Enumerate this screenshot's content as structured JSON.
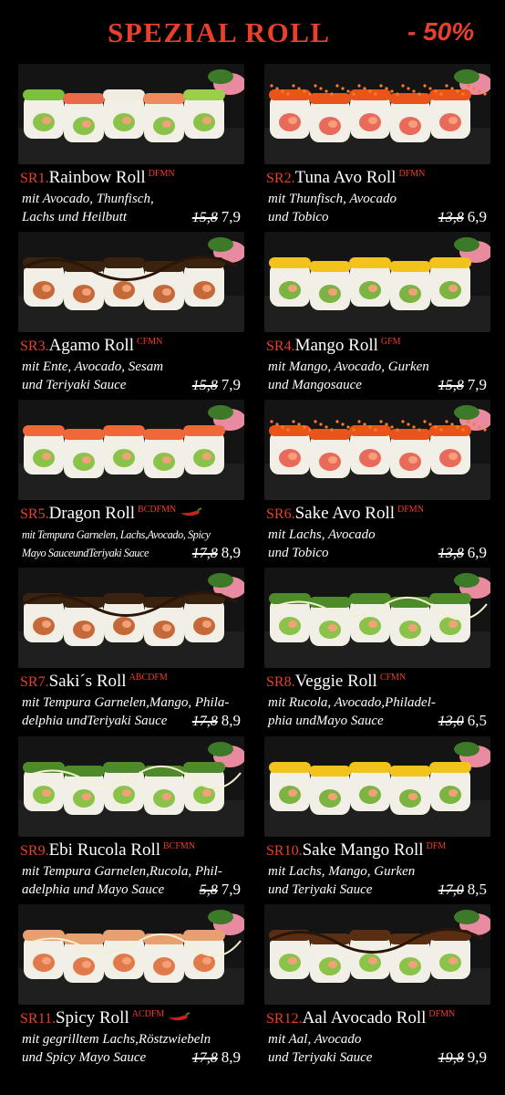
{
  "header": {
    "title": "SPEZIAL ROLL",
    "discount": "- 50%"
  },
  "rolls": [
    {
      "code": "SR1.",
      "name": "Rainbow Roll",
      "tags": "DFMN",
      "chili": false,
      "desc1": "mit Avocado, Thunfisch,",
      "desc2": "Lachs und Heilbutt",
      "old": "15,8",
      "new": "7,9",
      "style": "rainbow"
    },
    {
      "code": "SR2.",
      "name": "Tuna Avo Roll",
      "tags": "DFMN",
      "chili": false,
      "desc1": "mit Thunfisch, Avocado",
      "desc2": "und Tobico",
      "old": "13,8",
      "new": "6,9",
      "style": "tobico"
    },
    {
      "code": "SR3.",
      "name": "Agamo Roll",
      "tags": "CFMN",
      "chili": false,
      "desc1": "mit Ente, Avocado, Sesam",
      "desc2": "und Teriyaki Sauce",
      "old": "15,8",
      "new": "7,9",
      "style": "teriyaki"
    },
    {
      "code": "SR4.",
      "name": "Mango Roll",
      "tags": "GFM",
      "chili": false,
      "desc1": "mit Mango, Avocado, Gurken",
      "desc2": "und Mangosauce",
      "old": "15,8",
      "new": "7,9",
      "style": "mango"
    },
    {
      "code": "SR5.",
      "name": "Dragon Roll",
      "tags": "BCDFMN",
      "chili": true,
      "desc1": "mit Tempura Garnelen, Lachs,Avocado, Spicy",
      "desc2": "Mayo SauceundTeriyaki Sauce",
      "old": "17,8",
      "new": "8,9",
      "style": "salmon"
    },
    {
      "code": "SR6.",
      "name": "Sake Avo Roll",
      "tags": "DFMN",
      "chili": false,
      "desc1": "mit Lachs, Avocado",
      "desc2": "und Tobico",
      "old": "13,8",
      "new": "6,9",
      "style": "tobico"
    },
    {
      "code": "SR7.",
      "name": "Saki´s Roll",
      "tags": "ABCDFM",
      "chili": false,
      "desc1": "mit Tempura Garnelen,Mango, Phila-",
      "desc2": "delphia undTeriyaki Sauce",
      "old": "17,8",
      "new": "8,9",
      "style": "teriyaki"
    },
    {
      "code": "SR8.",
      "name": "Veggie Roll",
      "tags": "CFMN",
      "chili": false,
      "desc1": "mit Rucola, Avocado,Philadel-",
      "desc2": "phia undMayo Sauce",
      "old": "13,0",
      "new": "6,5",
      "style": "rucola"
    },
    {
      "code": "SR9.",
      "name": "Ebi Rucola Roll",
      "tags": "BCFMN",
      "chili": false,
      "desc1": "mit Tempura Garnelen,Rucola, Phil-",
      "desc2": "adelphia und Mayo Sauce",
      "old": "5,8",
      "new": "7,9",
      "style": "rucola"
    },
    {
      "code": "SR10.",
      "name": "Sake Mango Roll",
      "tags": "DFM",
      "chili": false,
      "desc1": "mit Lachs, Mango, Gurken",
      "desc2": "und Teriyaki Sauce",
      "old": "17,0",
      "new": "8,5",
      "style": "mango"
    },
    {
      "code": "SR11.",
      "name": "Spicy Roll",
      "tags": "ACDFM",
      "chili": true,
      "desc1": "mit gegrilltem Lachs,Röstzwiebeln",
      "desc2": "und Spicy Mayo Sauce",
      "old": "17,8",
      "new": "8,9",
      "style": "spicy"
    },
    {
      "code": "SR12.",
      "name": "Aal Avocado Roll",
      "tags": "DFMN",
      "chili": false,
      "desc1": "mit Aal, Avocado",
      "desc2": "und Teriyaki Sauce",
      "old": "19,8",
      "new": "9,9",
      "style": "eel"
    }
  ],
  "colors": {
    "accent": "#e8402a",
    "background": "#000000",
    "text": "#ffffff"
  }
}
